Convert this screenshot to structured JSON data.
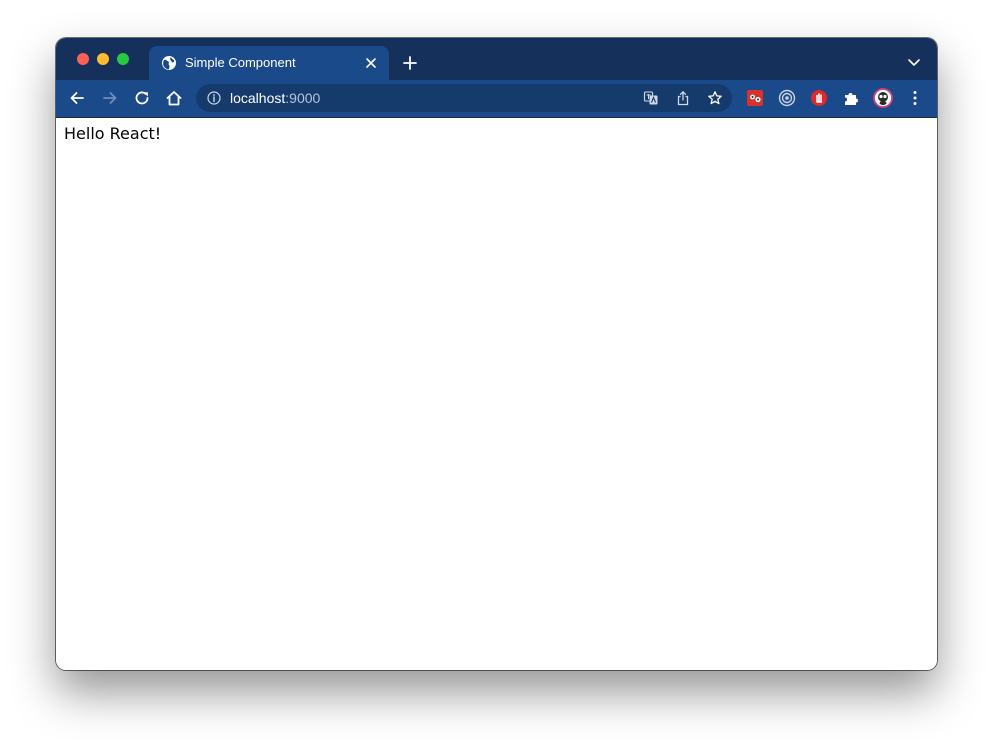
{
  "window": {
    "traffic_lights": [
      {
        "name": "close",
        "color": "#fe5f57"
      },
      {
        "name": "minimize",
        "color": "#febc2e"
      },
      {
        "name": "maximize",
        "color": "#28c840"
      }
    ]
  },
  "tabs": [
    {
      "title": "Simple Component",
      "icon": "globe-icon",
      "active": true
    }
  ],
  "toolbar": {
    "back_icon": "arrow-left-icon",
    "forward_icon": "arrow-right-icon",
    "reload_icon": "reload-icon",
    "home_icon": "home-icon"
  },
  "address_bar": {
    "host": "localhost",
    "port": ":9000",
    "security_icon": "info-icon",
    "actions": [
      "translate-icon",
      "share-icon",
      "bookmark-star-icon"
    ]
  },
  "extensions": [
    "extension-red-icon",
    "extension-target-icon",
    "extension-stop-hand-icon",
    "puzzle-icon",
    "profile-avatar-icon",
    "kebab-menu-icon"
  ],
  "colors": {
    "titlebar": "#15305a",
    "toolbar": "#1b4a8a",
    "omnibox": "#153a6c"
  },
  "page": {
    "text": "Hello React!"
  }
}
